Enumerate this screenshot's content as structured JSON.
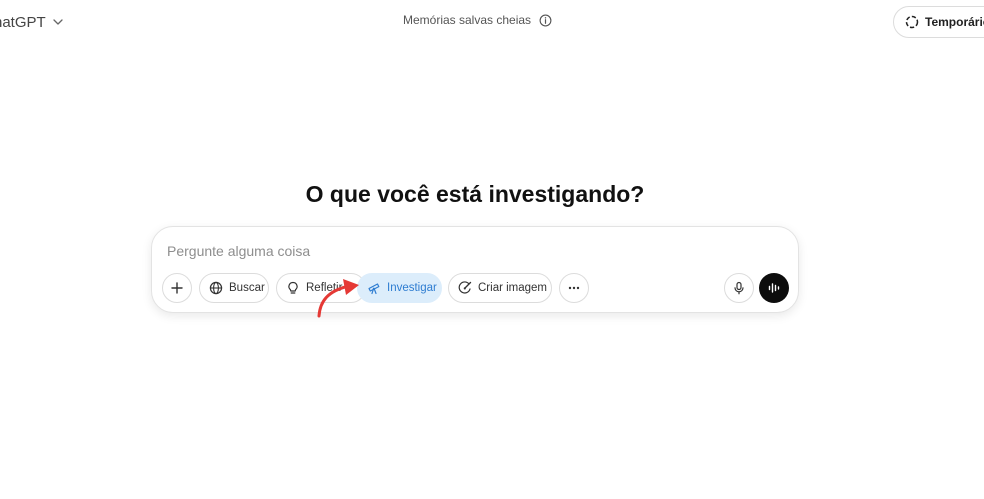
{
  "header": {
    "model_label": "hatGPT",
    "memory_status": "Memórias salvas cheias",
    "temporary_label": "Temporário"
  },
  "main": {
    "headline": "O que você está investigando?"
  },
  "composer": {
    "placeholder": "Pergunte alguma coisa",
    "tools": {
      "search_label": "Buscar",
      "reason_label": "Refletir",
      "research_label": "Investigar",
      "image_label": "Criar imagem"
    },
    "active_tool": "Investigar"
  },
  "colors": {
    "active_tool_bg": "#dcedfb",
    "active_tool_text": "#2f7dd1",
    "annotation_arrow": "#e53935",
    "voice_button_bg": "#0d0d0d"
  },
  "icons": [
    "chevron-down-icon",
    "info-icon",
    "dashed-circle-icon",
    "plus-icon",
    "globe-icon",
    "lightbulb-icon",
    "telescope-icon",
    "image-brush-icon",
    "ellipsis-icon",
    "microphone-icon",
    "voice-waveform-icon",
    "red-arrow-annotation"
  ]
}
